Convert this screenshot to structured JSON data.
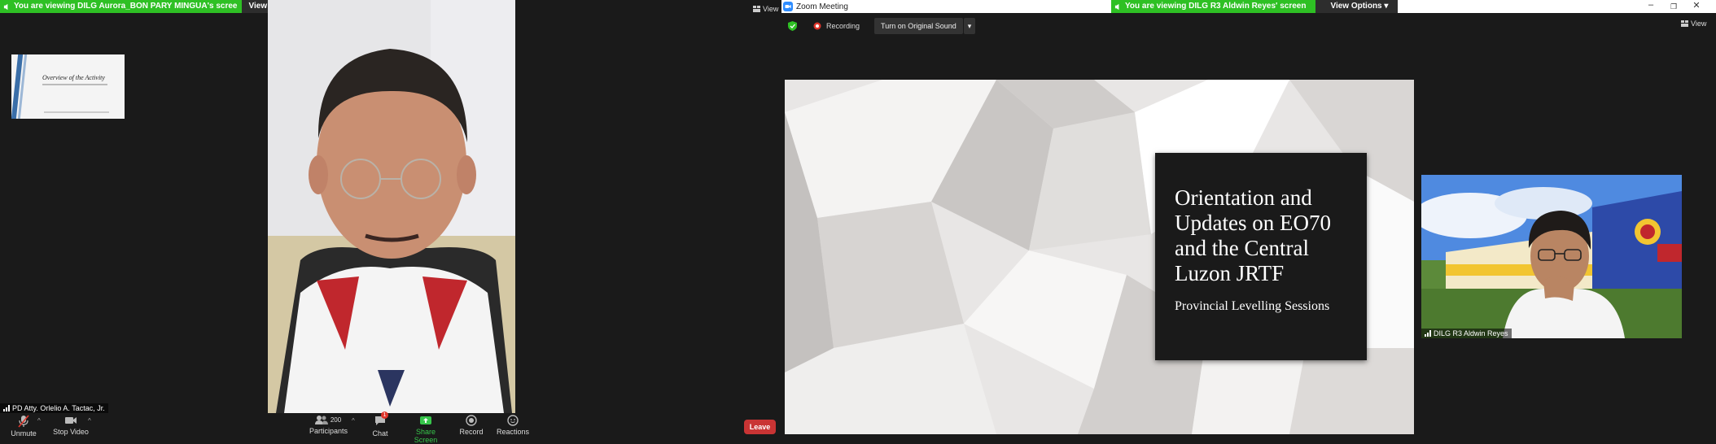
{
  "left_window": {
    "share_banner": "You are viewing DILG Aurora_BON PARY MINGUA's scree",
    "view_options": "View Options",
    "view_label": "View",
    "mini_slide_title": "Overview of the Activity",
    "participant_name": "PD Atty. Orlelio A. Tactac, Jr.",
    "toolbar": {
      "unmute": "Unmute",
      "stop_video": "Stop Video",
      "participants": "Participants",
      "participants_count": "200",
      "chat": "Chat",
      "chat_badge": "1",
      "share_screen": "Share Screen",
      "record": "Record",
      "reactions": "Reactions"
    },
    "leave": "Leave"
  },
  "right_window": {
    "title": "Zoom Meeting",
    "share_banner": "You are viewing DILG R3 Aldwin Reyes' screen",
    "view_options": "View Options",
    "view_label": "View",
    "recording": "Recording",
    "original_sound": "Turn on Original Sound",
    "slide": {
      "title": "Orientation and Updates on EO70 and the Central Luzon JRTF",
      "subtitle": "Provincial Levelling Sessions"
    },
    "video_name": "DILG R3 Aldwin Reyes"
  },
  "colors": {
    "share_green": "#2ec024",
    "leave_red": "#c93434",
    "share_screen_green": "#37c54b",
    "chat_badge": "#e0352b"
  }
}
